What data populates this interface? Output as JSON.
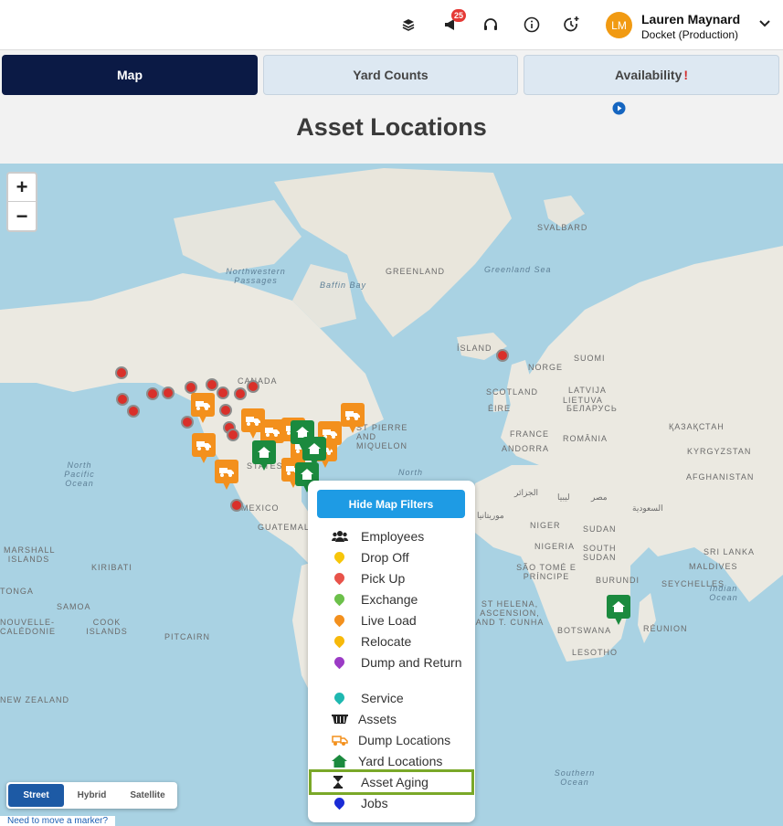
{
  "header": {
    "notification_count": "25",
    "avatar_initials": "LM",
    "user_name": "Lauren Maynard",
    "user_org": "Docket (Production)"
  },
  "tabs": [
    {
      "label": "Map",
      "active": true
    },
    {
      "label": "Yard Counts",
      "active": false
    },
    {
      "label": "Availability",
      "warning": "!",
      "active": false
    }
  ],
  "page_title": "Asset Locations",
  "map": {
    "zoom_in": "+",
    "zoom_out": "−",
    "labels": {
      "greenland": "GREENLAND",
      "svalbard": "SVALBARD",
      "greenland_sea": "Greenland Sea",
      "northwestern_passages": "Northwestern Passages",
      "baffin_bay": "Baffin Bay",
      "island": "ÍSLAND",
      "norge": "NORGE",
      "suomi": "SUOMI",
      "scotland": "SCOTLAND",
      "eire": "ÉIRE",
      "latvija": "LATVIJA",
      "lietuva": "LIETUVA",
      "belarus": "БЕЛАРУСЬ",
      "kazakhstan": "ҚАЗАҚСТАН",
      "france": "FRANCE",
      "romania": "ROMÂNIA",
      "kyrgyzstan": "KYRGYZSTAN",
      "andorra": "ANDORRA",
      "afghanistan": "AFGHANISTAN",
      "algeria": "الجزائر",
      "libya": "ليبيا",
      "egypt": "مصر",
      "saudi": "السعودية",
      "mauritania": "موريتانيا",
      "niger": "NIGER",
      "sudan": "SUDAN",
      "nigeria": "NIGERIA",
      "south_sudan": "SOUTH SUDAN",
      "sao_tome": "SÃO TOMÉ E PRÍNCIPE",
      "burundi": "BURUNDI",
      "seychelles": "SEYCHELLES",
      "maldives": "MALDIVES",
      "sri_lanka": "SRI LANKA",
      "indian_ocean": "Indian Ocean",
      "st_helena": "ST HELENA, ASCENSION, AND T. CUNHA",
      "botswana": "BOTSWANA",
      "lesotho": "LESOTHO",
      "reunion": "RÉUNION",
      "southern_ocean": "Southern Ocean",
      "st_pierre": "ST PIERRE AND MIQUELON",
      "north_pacific": "North Pacific Ocean",
      "north_atlantic": "North",
      "mexico": "MEXICO",
      "guatemala": "GUATEMALA",
      "marshall": "MARSHALL ISLANDS",
      "kiribati": "KIRIBATI",
      "samoa": "SAMOA",
      "cook": "COOK ISLANDS",
      "pitcairn": "PITCAIRN",
      "nouvelle": "NOUVELLE-CALÉDONIE",
      "tonga": "TONGA",
      "new_zealand": "NEW ZEALAND",
      "canada": "CANADA",
      "states": "STATES"
    },
    "map_types": [
      "Street",
      "Hybrid",
      "Satellite"
    ],
    "active_map_type": "Street",
    "move_marker_link": "Need to move a marker?"
  },
  "filters": {
    "hide_button": "Hide Map Filters",
    "items": [
      {
        "label": "Employees",
        "icon": "employees-icon",
        "color": "#222222"
      },
      {
        "label": "Drop Off",
        "icon": "drop-off-marker-icon",
        "color": "#f7c60a"
      },
      {
        "label": "Pick Up",
        "icon": "pick-up-marker-icon",
        "color": "#e8534a"
      },
      {
        "label": "Exchange",
        "icon": "exchange-marker-icon",
        "color": "#6cc04a"
      },
      {
        "label": "Live Load",
        "icon": "live-load-marker-icon",
        "color": "#f3901d"
      },
      {
        "label": "Relocate",
        "icon": "relocate-marker-icon",
        "color": "#f7b90a"
      },
      {
        "label": "Dump and Return",
        "icon": "dump-return-marker-icon",
        "color": "#9b3bc5"
      },
      {
        "label": "Service",
        "icon": "service-marker-icon",
        "color": "#1fb8b0"
      },
      {
        "label": "Assets",
        "icon": "assets-icon",
        "color": "#222222"
      },
      {
        "label": "Dump Locations",
        "icon": "dump-truck-icon",
        "color": "#f3901d"
      },
      {
        "label": "Yard Locations",
        "icon": "home-icon",
        "color": "#1b8a3e"
      },
      {
        "label": "Asset Aging",
        "icon": "hourglass-icon",
        "color": "#222222",
        "highlighted": true
      },
      {
        "label": "Jobs",
        "icon": "jobs-marker-icon",
        "color": "#1a2bd6"
      }
    ]
  }
}
